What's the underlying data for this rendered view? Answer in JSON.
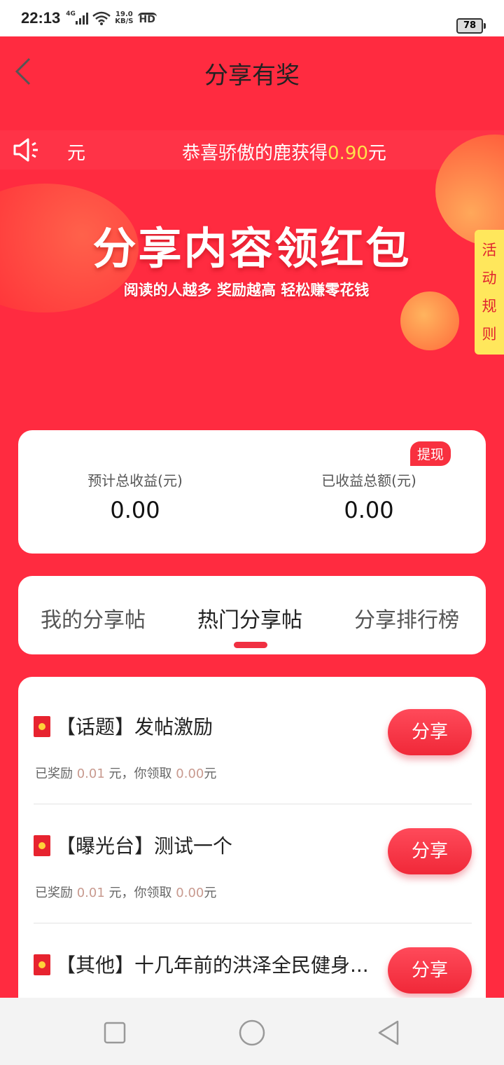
{
  "status": {
    "time": "22:13",
    "network": "4G",
    "speed_value": "19.0",
    "speed_unit": "KB/S",
    "hd": "HD",
    "battery": "78"
  },
  "header": {
    "title": "分享有奖"
  },
  "marquee": {
    "left_fragment": "元",
    "prefix": "恭喜骄傲的鹿获得",
    "amount": "0.90",
    "suffix": "元"
  },
  "banner": {
    "title": "分享内容领红包",
    "subtitle": "阅读的人越多  奖励越高  轻松赚零花钱",
    "rules_chars": [
      "活",
      "动",
      "规",
      "则"
    ]
  },
  "earnings": {
    "withdraw_label": "提现",
    "estimated": {
      "label": "预计总收益(元)",
      "value": "0.00"
    },
    "received": {
      "label": "已收益总额(元)",
      "value": "0.00"
    }
  },
  "tabs": [
    {
      "label": "我的分享帖",
      "active": false
    },
    {
      "label": "热门分享帖",
      "active": true
    },
    {
      "label": "分享排行榜",
      "active": false
    }
  ],
  "posts": [
    {
      "title": "【话题】发帖激励",
      "reward_prefix": "已奖励",
      "reward": "0.01",
      "reward_mid": "元，你领取",
      "claimed": "0.00",
      "claimed_unit": "元",
      "share_label": "分享"
    },
    {
      "title": "【曝光台】测试一个",
      "reward_prefix": "已奖励",
      "reward": "0.01",
      "reward_mid": "元，你领取",
      "claimed": "0.00",
      "claimed_unit": "元",
      "share_label": "分享"
    },
    {
      "title": "【其他】十几年前的洪泽全民健身...",
      "share_label": "分享"
    }
  ],
  "colors": {
    "primary_red": "#ff2b40",
    "accent_yellow": "#ffe14a",
    "button_red": "#f02838"
  },
  "icons": {
    "back": "chevron-left-icon",
    "speaker": "speaker-icon",
    "nav_recent": "square-icon",
    "nav_home": "circle-icon",
    "nav_back": "triangle-back-icon"
  }
}
